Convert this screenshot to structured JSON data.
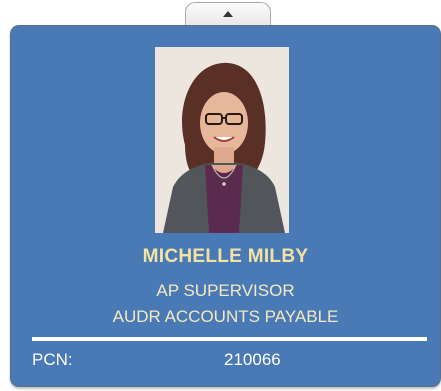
{
  "employee": {
    "name": "MICHELLE MILBY",
    "title": "AP SUPERVISOR",
    "department": "AUDR ACCOUNTS PAYABLE",
    "pcn_label": "PCN:",
    "pcn_value": "210066"
  },
  "icons": {
    "collapse_tab": "chevron-up-icon",
    "photo": "employee-photo"
  },
  "colors": {
    "card_background": "#4a7ab5",
    "name_text": "#f2e3a3",
    "detail_text": "#f4e9c2",
    "divider": "#ffffff"
  }
}
